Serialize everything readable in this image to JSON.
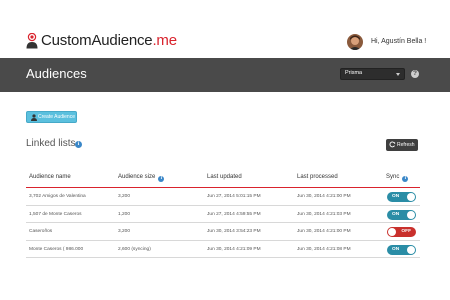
{
  "brand": {
    "name": "CustomAudience",
    "tld": ".me"
  },
  "user": {
    "greeting": "Hi, Agustín Bella !"
  },
  "header": {
    "title": "Audiences",
    "select_value": "Prisma",
    "help": "?"
  },
  "actions": {
    "create_label": "Create Audience",
    "refresh_label": "Refresh"
  },
  "section": {
    "title": "Linked lists",
    "info": "i"
  },
  "table": {
    "columns": [
      "Audience name",
      "Audience size",
      "Last updated",
      "Last processed",
      "Sync"
    ],
    "rows": [
      {
        "name": "3,702 Amigos de Valentina",
        "size": "3,200",
        "updated": "Jun 27, 2014 5:01:15 PM",
        "processed": "Jun 30, 2014 4:21:00 PM",
        "sync": "ON"
      },
      {
        "name": "1,507 de Monte Caseros",
        "size": "1,200",
        "updated": "Jun 27, 2014 4:59:55 PM",
        "processed": "Jun 30, 2014 4:21:03 PM",
        "sync": "ON"
      },
      {
        "name": "Caseroños",
        "size": "3,200",
        "updated": "Jun 30, 2014 3:54:23 PM",
        "processed": "Jun 30, 2014 4:21:00 PM",
        "sync": "OFF"
      },
      {
        "name": "Monte Caseros ( 986.000",
        "size": "2,600 (syncing)",
        "updated": "Jun 30, 2014 4:21:09 PM",
        "processed": "Jun 30, 2014 4:21:08 PM",
        "sync": "ON"
      }
    ]
  },
  "colors": {
    "accent_red": "#d9232d",
    "header_bg": "#4a4a4a",
    "toggle_on": "#2a8da6",
    "toggle_off": "#c9302c",
    "create_button": "#5bc0de"
  }
}
